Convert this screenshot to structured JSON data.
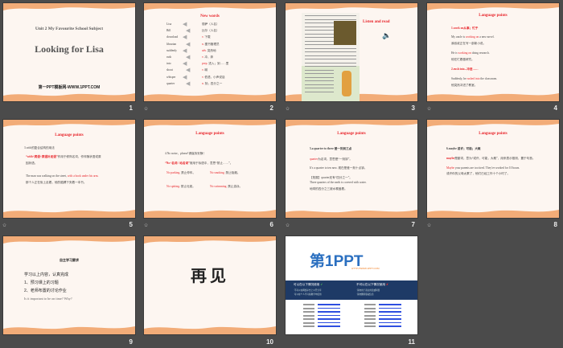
{
  "slides": [
    {
      "number": "1",
      "subtitle": "Unit 2 My Favourite School Subject",
      "title": "Looking for Lisa",
      "footer": "第一PPT模板网-WWW.1PPT.COM"
    },
    {
      "number": "2",
      "title": "New words",
      "words": [
        {
          "en": "Lisa",
          "pos": "",
          "cn": "丽萨（人名）"
        },
        {
          "en": "Bill",
          "pos": "",
          "cn": "比尔（人名）"
        },
        {
          "en": "download",
          "pos": "v.",
          "cn": "下载"
        },
        {
          "en": "librarian",
          "pos": "n.",
          "cn": "图书管理员"
        },
        {
          "en": "suddenly",
          "pos": "adv.",
          "cn": "突然地"
        },
        {
          "en": "rush",
          "pos": "v.",
          "cn": "冲，奔"
        },
        {
          "en": "into",
          "pos": "prep.",
          "cn": "进入；到……里"
        },
        {
          "en": "shout",
          "pos": "v.",
          "cn": "喊"
        },
        {
          "en": "whisper",
          "pos": "v.",
          "cn": "低语，小声说话"
        },
        {
          "en": "quarter",
          "pos": "n.",
          "cn": "刻；四分之一"
        }
      ]
    },
    {
      "number": "3",
      "title": "Listen and read"
    },
    {
      "number": "4",
      "title": "Language points",
      "p1": "1.work on从事；忙于",
      "l1a": "My uncle is ",
      "l1b": "working on",
      "l1c": " a new novel.",
      "l1d": "我叔叔正在写一部新小说。",
      "l2a": "He is ",
      "l2b": "working on",
      "l2c": " doing research.",
      "l2d": "他在忙着做研究。",
      "p2": "2.rush into...冲进……",
      "l3a": "Suddenly, he ",
      "l3b": "rushed into",
      "l3c": " the classroom.",
      "l3d": "他突然冲进了教室。"
    },
    {
      "number": "5",
      "title": "Language points",
      "p1": "3.with的复合结构的用法",
      "l1a": "“with+宾语+宾语补足语”",
      "l1b": "作用于修饰名词，作伴随状语或原",
      "l1c": "因状语。",
      "l2a": "The man was walking on the street, ",
      "l2b": "with a book under his arm.",
      "l2c": "那个人正在街上走着，他的胳膊下夹着一本书。"
    },
    {
      "number": "6",
      "title": "Language points",
      "p1": "4.No noise，please!请保持安静！",
      "l1a": "“No+名词 / 动名词”",
      "l1b": "常用于标语中，意思“禁止……”。",
      "ex": [
        {
          "en": "No parking.",
          "cn": "禁止停车。"
        },
        {
          "en": "No smoking.",
          "cn": "禁止吸烟。"
        },
        {
          "en": "No spitting.",
          "cn": "禁止吐痰。"
        },
        {
          "en": "No swimming.",
          "cn": "禁止游泳。"
        }
      ]
    },
    {
      "number": "7",
      "title": "Language points",
      "p1": "5.a quarter to three 差一刻到三点",
      "l1a": "quarter",
      "l1b": "为名词，意思是“一刻钟”。",
      "l2": "It's a quarter to ten now. 现在是差一刻十点钟。",
      "l3": "【拓展】quarter还有“四分之一”。",
      "l4": "Three quarters of the earth is covered with water.",
      "l5": "地球的四分之三被水覆盖着。"
    },
    {
      "number": "8",
      "title": "Language points",
      "p1": "6.maybe 或许；可能；大概",
      "l1a": "maybe",
      "l1b": "是副词，意为“或许，可能，大概”，用来表示推测，置于句首。",
      "l2a": "Maybe",
      "l2b": " your parents are too tired. They've worked for 10 hours.",
      "l2c": "或许你的父母太累了，他们已经工作十个小时了。"
    },
    {
      "number": "9",
      "title": "自主学习要求",
      "l1": "学习以上内容，认真完成",
      "l2": "1、预习课上的习题",
      "l3": "2、老师布置的讨论作业",
      "l4": "Is it important to be on time? Why?"
    },
    {
      "number": "10",
      "title": "再见"
    },
    {
      "number": "11",
      "logo": "第1PPT",
      "url": "HTTP://WWW.1PPT.COM",
      "can": "可以在以下情况使用",
      "cannot": "不可以在以下情况使用",
      "can1": "·不可以在网络平台上公开分享",
      "can2": "·可以在个人学习和教学中使用",
      "no1": "·请勿用于商业用途或转售",
      "no2": "·请勿删除版权信息"
    }
  ],
  "colors": {
    "background": "#4b4b4b",
    "slide": "#fdf6f1",
    "wave": "#f2ac78",
    "accent": "#e8242a",
    "band": "#1e3a66"
  }
}
